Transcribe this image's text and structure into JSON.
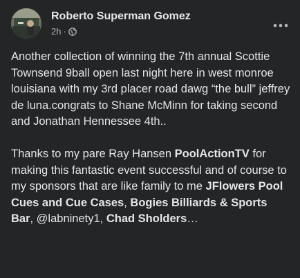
{
  "post": {
    "author": "Roberto Superman Gomez",
    "timestamp": "2h",
    "separator": "·",
    "privacy_icon": "globe-icon",
    "more_icon": "more-horizontal-icon",
    "paragraph1": "Another collection of winning the 7th annual Scottie Townsend 9ball open last night here in west monroe louisiana with my 3rd placer road dawg “the bull” jeffrey de luna.congrats to Shane McMinn for taking second and Jonathan Hennessee 4th..",
    "paragraph2": {
      "intro": "Thanks to my pare Ray Hansen ",
      "mention1": "PoolActionTV",
      "mid1": " for making this fantastic event successful and of course to my sponsors that are like family to me ",
      "mention2": "JFlowers Pool Cues and Cue Cases",
      "sep1": ", ",
      "mention3": "Bogies Billiards & Sports Bar",
      "sep2": ", @labninety1, ",
      "mention4": "Chad Sholders",
      "ellipsis": "…"
    }
  },
  "colors": {
    "background": "#242526",
    "primary_text": "#e4e6eb",
    "secondary_text": "#b0b3b8"
  }
}
